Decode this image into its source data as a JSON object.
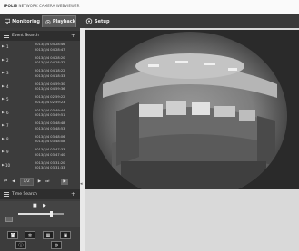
{
  "app": {
    "title_brand": "iPOLiS",
    "title_text": "NETWORK CAMERA WEBVIEWER"
  },
  "tabs": [
    {
      "label": "Monitoring",
      "icon": "monitor-icon",
      "active": false
    },
    {
      "label": "Playback",
      "icon": "playback-icon",
      "active": true
    },
    {
      "label": "Setup",
      "icon": "gear-icon",
      "active": false
    }
  ],
  "event_search": {
    "label": "Event Search",
    "add_symbol": "+"
  },
  "results": [
    {
      "num": "1",
      "start": "2013/3/4 04:28:46",
      "end": "2013/3/4 04:28:47"
    },
    {
      "num": "2",
      "start": "2013/3/4 04:28:20",
      "end": "2013/3/4 04:28:32"
    },
    {
      "num": "3",
      "start": "2013/3/4 04:18:22",
      "end": "2013/3/4 04:18:33"
    },
    {
      "num": "4",
      "start": "2013/3/4 04:59:30",
      "end": "2013/3/4 04:59:36"
    },
    {
      "num": "5",
      "start": "2013/3/4 02:59:22",
      "end": "2013/3/4 02:59:23"
    },
    {
      "num": "6",
      "start": "2013/3/4 03:49:44",
      "end": "2013/3/4 03:49:51"
    },
    {
      "num": "7",
      "start": "2013/3/4 03:48:48",
      "end": "2013/3/4 03:48:53"
    },
    {
      "num": "8",
      "start": "2013/3/4 03:48:06",
      "end": "2013/3/4 03:48:08"
    },
    {
      "num": "9",
      "start": "2013/3/4 03:47:33",
      "end": "2013/3/4 03:47:40"
    },
    {
      "num": "10",
      "start": "2013/3/4 03:31:20",
      "end": "2013/3/4 03:31:33"
    }
  ],
  "pager": {
    "first": "⏮",
    "prev": "◀",
    "page": "1/2",
    "next": "▶",
    "last": "⏭",
    "go": "▶"
  },
  "time_search": {
    "label": "Time Search",
    "add_symbol": "+"
  },
  "controls": {
    "stop": "■",
    "play": "▶",
    "speed_level": 0.72
  },
  "toolbar": {
    "capture": "◙",
    "settings": "✲",
    "split": "▦",
    "fullscreen": "▣",
    "info": "ⓘ",
    "audio": "◍"
  },
  "colors": {
    "sidebar": "#3c3c3c",
    "tabbar": "#3a3a3a",
    "viewer_bg": "#d9d9d9",
    "video_bg": "#2b2b2b"
  }
}
